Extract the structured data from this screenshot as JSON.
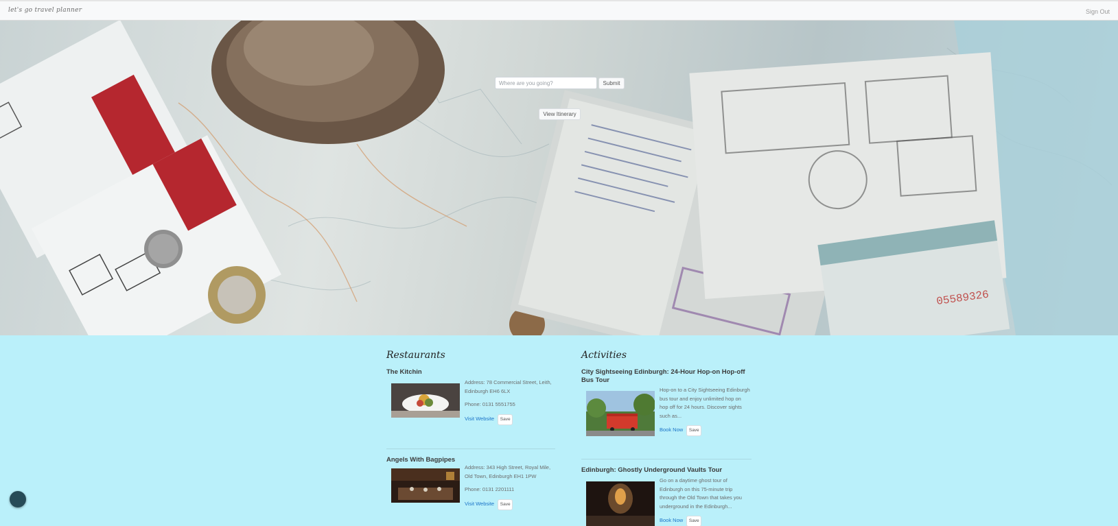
{
  "navbar": {
    "brand": "let's go travel planner",
    "sign_out": "Sign Out"
  },
  "hero": {
    "search_placeholder": "Where are you going?",
    "submit_label": "Submit",
    "view_itinerary_label": "View Itinerary"
  },
  "restaurants": {
    "heading": "Restaurants",
    "items": [
      {
        "name": "The Kitchin",
        "address": "Address: 78 Commercial Street, Leith, Edinburgh EH6 6LX",
        "phone": "Phone: 0131 5551755",
        "link_label": "Visit Website",
        "save_label": "Save"
      },
      {
        "name": "Angels With Bagpipes",
        "address": "Address: 343 High Street, Royal Mile, Old Town, Edinburgh EH1 1PW",
        "phone": "Phone: 0131 2201111",
        "link_label": "Visit Website",
        "save_label": "Save"
      }
    ]
  },
  "activities": {
    "heading": "Activities",
    "items": [
      {
        "name": "City Sightseeing Edinburgh: 24-Hour Hop-on Hop-off Bus Tour",
        "description": "Hop-on to a City Sightseeing Edinburgh bus tour and enjoy unlimited hop on hop off for 24 hours. Discover sights such as...",
        "link_label": "Book Now",
        "save_label": "Save"
      },
      {
        "name": "Edinburgh: Ghostly Underground Vaults Tour",
        "description": "Go on a daytime ghost tour of Edinburgh on this 75-minute trip through the Old Town that takes you underground in the Edinburgh...",
        "link_label": "Book Now",
        "save_label": "Save"
      }
    ]
  },
  "icons": {
    "floating_button": "compass-icon"
  },
  "colors": {
    "page_background": "#baf0fa",
    "link": "#1a73c7",
    "ticket_red": "#b5272f"
  }
}
